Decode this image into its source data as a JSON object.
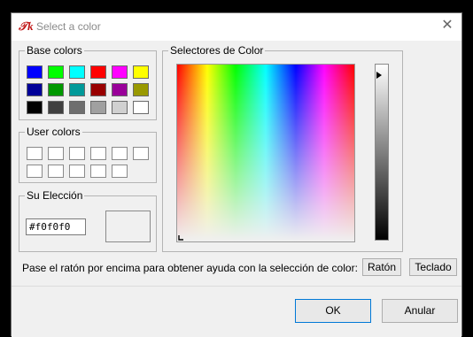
{
  "window": {
    "title": "Select a color",
    "icon": "tk-feather-icon",
    "close_icon": "close-icon"
  },
  "base_colors": {
    "label": "Base colors",
    "swatches": [
      "#0000ff",
      "#00ff00",
      "#00ffff",
      "#ff0000",
      "#ff00ff",
      "#ffff00",
      "#000099",
      "#009900",
      "#009999",
      "#990000",
      "#990099",
      "#999900",
      "#000000",
      "#404040",
      "#6e6e6e",
      "#a0a0a0",
      "#d0d0d0",
      "#ffffff"
    ]
  },
  "user_colors": {
    "label": "User colors",
    "count": 11
  },
  "selection": {
    "label": "Su Elección",
    "hex_value": "#f0f0f0",
    "preview_color": "#f0f0f0"
  },
  "selectors": {
    "label": "Selectores de Color"
  },
  "help": {
    "text": "Pase el ratón por encima para obtener ayuda con la selección de color:",
    "mouse_button": "Ratón",
    "keyboard_button": "Teclado"
  },
  "buttons": {
    "ok": "OK",
    "cancel": "Anular"
  }
}
